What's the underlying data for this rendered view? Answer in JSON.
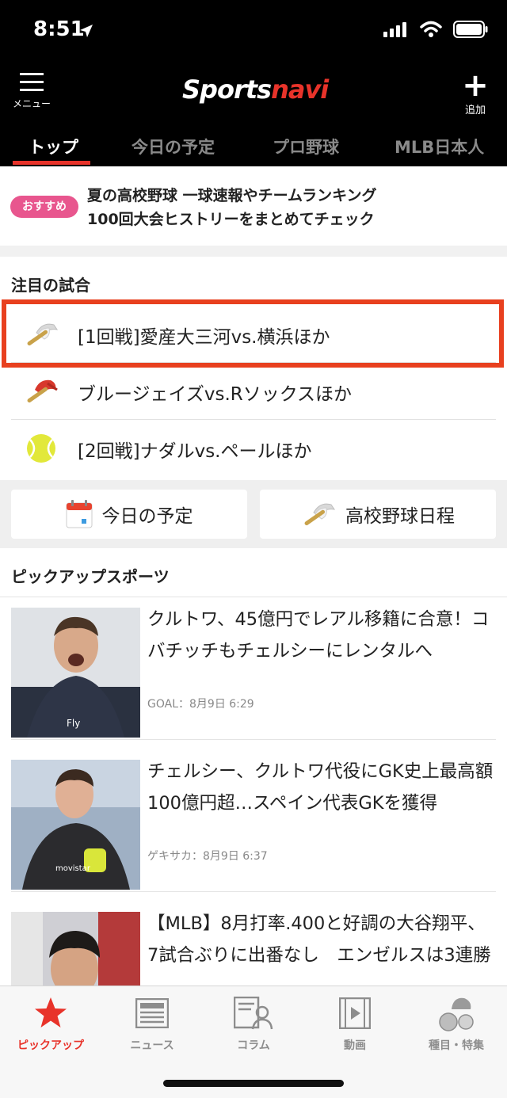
{
  "status_bar": {
    "time": "8:51"
  },
  "header": {
    "menu_label": "メニュー",
    "logo_part1": "Sports",
    "logo_part2": "navi",
    "add_label": "追加"
  },
  "tabs": [
    {
      "label": "トップ",
      "active": true
    },
    {
      "label": "今日の予定",
      "active": false
    },
    {
      "label": "プロ野球",
      "active": false
    },
    {
      "label": "MLB日本人",
      "active": false
    }
  ],
  "promo": {
    "badge": "おすすめ",
    "line1": "夏の高校野球 一球速報やチームランキング",
    "line2": "100回大会ヒストリーをまとめてチェック"
  },
  "featured": {
    "title": "注目の試合",
    "items": [
      {
        "text": "[1回戦]愛産大三河vs.横浜ほか",
        "icon": "high-school-baseball-icon",
        "highlighted": true
      },
      {
        "text": "ブルージェイズvs.Rソックスほか",
        "icon": "mlb-baseball-icon",
        "highlighted": false
      },
      {
        "text": "[2回戦]ナダルvs.ペールほか",
        "icon": "tennis-ball-icon",
        "highlighted": false
      }
    ]
  },
  "quick_buttons": [
    {
      "label": "今日の予定",
      "icon": "calendar-icon"
    },
    {
      "label": "高校野球日程",
      "icon": "high-school-baseball-icon"
    }
  ],
  "pickup": {
    "title": "ピックアップスポーツ",
    "articles": [
      {
        "headline": "クルトワ、45億円でレアル移籍に合意！コバチッチもチェルシーにレンタルへ",
        "meta": "GOAL：8月9日 6:29"
      },
      {
        "headline": "チェルシー、クルトワ代役にGK史上最高額100億円超…スペイン代表GKを獲得",
        "meta": "ゲキサカ：8月9日 6:37"
      },
      {
        "headline": "【MLB】8月打率.400と好調の大谷翔平、7試合ぶりに出番なし　エンゼルスは3連勝",
        "meta": ""
      }
    ]
  },
  "tab_bar": [
    {
      "label": "ピックアップ",
      "icon": "star-icon",
      "active": true
    },
    {
      "label": "ニュース",
      "icon": "newspaper-icon",
      "active": false
    },
    {
      "label": "コラム",
      "icon": "column-icon",
      "active": false
    },
    {
      "label": "動画",
      "icon": "video-icon",
      "active": false
    },
    {
      "label": "種目・特集",
      "icon": "sports-category-icon",
      "active": false
    }
  ],
  "colors": {
    "accent": "#e8332a",
    "badge": "#e8568e",
    "highlight_border": "#e8401f"
  }
}
